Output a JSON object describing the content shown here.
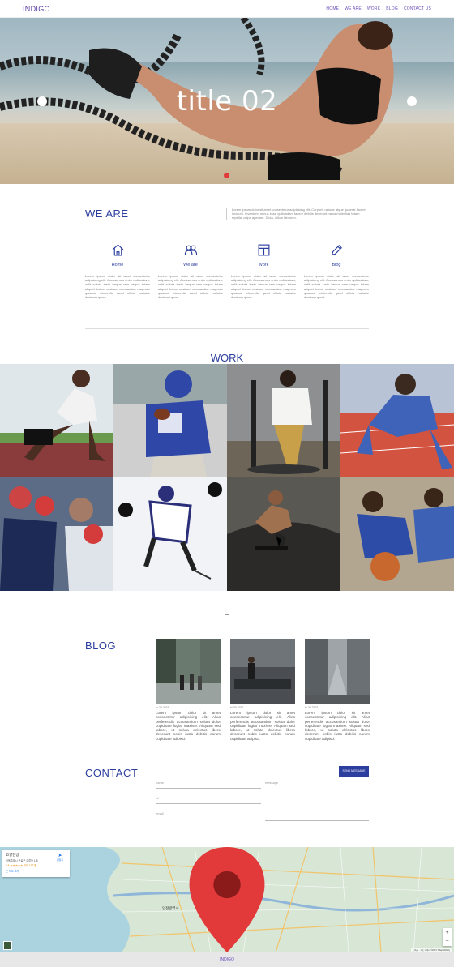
{
  "header": {
    "logo": "INDIGO",
    "nav": [
      "HOME",
      "WE ARE",
      "WORK",
      "BLOG",
      "CONTACT US"
    ]
  },
  "hero": {
    "title": "title 02"
  },
  "weare": {
    "title": "WE ARE",
    "description": "Lorem ipsum dolor sit amet consectetur adipisicing elit. Corporis ratione atque quaerat facere incidunt. Inventore, minus esse quibusdam facere debitis deserunt natus molestias totam repellat culpa aperiam. Dicta, cillum laborum.",
    "features": [
      {
        "icon": "home-icon",
        "label": "Home",
        "text": "Lorem ipsum dolor sit amet consectetur adipisicing elit. Accusamus enim quibusdam, velit soluta iusto beque rem neque totam aliquid dolore nostrum recusandae magnam quaerat reiciendis quod officia pariatur ducimus quod."
      },
      {
        "icon": "users-icon",
        "label": "We are",
        "text": "Lorem ipsum dolor sit amet consectetur adipisicing elit. Accusamus enim quibusdam, velit soluta iusto beque rem neque totam aliquid dolore nostrum recusandae magnam quaerat reiciendis quod officia pariatur ducimus quod."
      },
      {
        "icon": "layout-icon",
        "label": "Work",
        "text": "Lorem ipsum dolor sit amet consectetur adipisicing elit. Accusamus enim quibusdam, velit soluta iusto beque rem neque totam aliquid dolore nostrum recusandae magnam quaerat reiciendis quod officia pariatur ducimus quod."
      },
      {
        "icon": "pencil-icon",
        "label": "Blog",
        "text": "Lorem ipsum dolor sit amet consectetur adipisicing elit. Accusamus enim quibusdam, velit soluta iusto beque rem neque totam aliquid dolore nostrum recusandae magnam quaerat reiciendis quod officia pariatur ducimus quod."
      }
    ]
  },
  "work": {
    "title": "WORK"
  },
  "blog": {
    "title": "BLOG",
    "posts": [
      {
        "date": "to 30 2021",
        "text": "Lorem ipsum dolor sit amet consectetur adipisicing elit. Alias perferendis accusantium soluta dolor cupiditate fugiat maxime. Aliquam sed labore, ut soluta delectus libero deserunt nobis iusto debitis earum cupiditate adipisci."
      },
      {
        "date": "to 30 2021",
        "text": "Lorem ipsum dolor sit amet consectetur adipisicing elit. Alias perferendis accusantium soluta dolor cupiditate fugiat maxime. Aliquam sed labore, ut soluta delectus libero deserunt nobis iusto debitis earum cupiditate adipisci."
      },
      {
        "date": "to 30 2021",
        "text": "Lorem ipsum dolor sit amet consectetur adipisicing elit. Alias perferendis accusantium soluta dolor cupiditate fugiat maxime. Aliquam sed labore, ut soluta delectus libero deserunt nobis iusto debitis earum cupiditate adipisci."
      }
    ]
  },
  "contact": {
    "title": "CONTACT",
    "send_label": "SEND MESSAGE",
    "fields": {
      "name": "name",
      "tel": "tel",
      "email": "email",
      "message": "message"
    }
  },
  "map": {
    "place": "고양한방",
    "address": "서울특별시 구로구 오류동 1-8",
    "rating": "4.8 ★★★★★ 리뷰 197개",
    "link": "큰 지도 보기",
    "directions": "길찾기",
    "city_label": "인천광역시",
    "attribution": "단축키 · 지도 데이터 ©2021 TMap Mobility"
  },
  "footer": {
    "text": "INDIGO"
  },
  "colors": {
    "accent": "#2c3e9e",
    "brand": "#6b4fbb",
    "pin": "#e23a3a"
  }
}
